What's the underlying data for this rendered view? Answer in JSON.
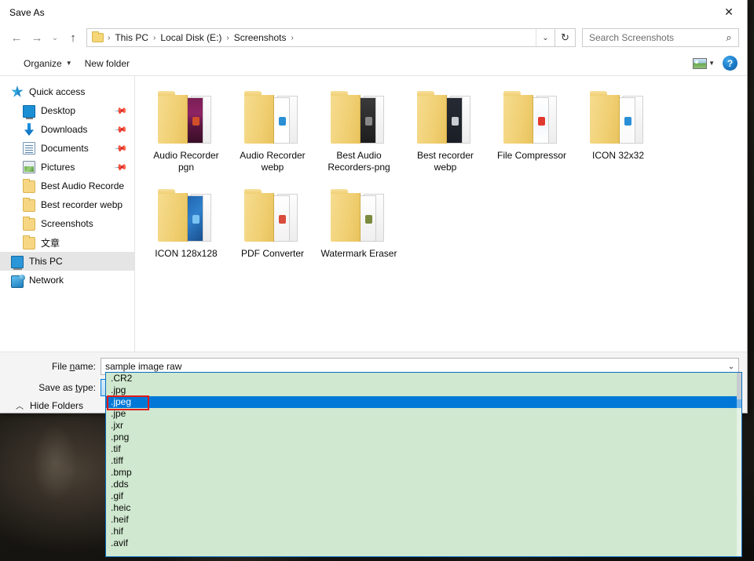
{
  "window": {
    "title": "Save As",
    "close_label": "✕"
  },
  "nav": {
    "back_icon": "←",
    "forward_icon": "→",
    "recent_icon": "⌄",
    "up_icon": "↑",
    "breadcrumbs": [
      "This PC",
      "Local Disk (E:)",
      "Screenshots"
    ],
    "separator": "›",
    "address_chevron": "⌄",
    "refresh_icon": "↻"
  },
  "search": {
    "placeholder": "Search Screenshots",
    "value": "",
    "icon": "⌕"
  },
  "commandbar": {
    "organize_label": "Organize",
    "organize_caret": "▼",
    "new_folder_label": "New folder",
    "view_caret": "▼",
    "help_label": "?"
  },
  "sidebar": {
    "items": [
      {
        "label": "Quick access",
        "icon": "quick-access-icon",
        "indent": 0,
        "pinned": false,
        "selected": false
      },
      {
        "label": "Desktop",
        "icon": "desktop-icon",
        "indent": 1,
        "pinned": true,
        "selected": false
      },
      {
        "label": "Downloads",
        "icon": "downloads-icon",
        "indent": 1,
        "pinned": true,
        "selected": false
      },
      {
        "label": "Documents",
        "icon": "documents-icon",
        "indent": 1,
        "pinned": true,
        "selected": false
      },
      {
        "label": "Pictures",
        "icon": "pictures-icon",
        "indent": 1,
        "pinned": true,
        "selected": false
      },
      {
        "label": "Best Audio Recorde",
        "icon": "folder-icon",
        "indent": 1,
        "pinned": false,
        "selected": false
      },
      {
        "label": "Best recorder webp",
        "icon": "folder-icon",
        "indent": 1,
        "pinned": false,
        "selected": false
      },
      {
        "label": "Screenshots",
        "icon": "folder-icon",
        "indent": 1,
        "pinned": false,
        "selected": false
      },
      {
        "label": "文章",
        "icon": "folder-icon",
        "indent": 1,
        "pinned": false,
        "selected": false
      },
      {
        "label": "This PC",
        "icon": "this-pc-icon",
        "indent": 0,
        "pinned": false,
        "selected": true
      },
      {
        "label": "Network",
        "icon": "network-icon",
        "indent": 0,
        "pinned": false,
        "selected": false
      }
    ],
    "pin_glyph": "📌"
  },
  "files": {
    "items": [
      {
        "name": "Audio Recorder pgn",
        "preview": "purple-ui"
      },
      {
        "name": "Audio Recorder webp",
        "preview": "dark-ui"
      },
      {
        "name": "Best Audio Recorders-png",
        "preview": "dark-doc"
      },
      {
        "name": "Best recorder webp",
        "preview": "dark-panel"
      },
      {
        "name": "File Compressor",
        "preview": "pdf-red"
      },
      {
        "name": "ICON 32x32",
        "preview": "small-blue-icon"
      },
      {
        "name": "ICON 128x128",
        "preview": "blue-tiles"
      },
      {
        "name": "PDF Converter",
        "preview": "doc-list"
      },
      {
        "name": "Watermark Eraser",
        "preview": "photo-doc"
      }
    ]
  },
  "form": {
    "file_name_label": "File name:",
    "file_name_value": "sample image raw",
    "save_as_type_label": "Save as type:",
    "save_as_type_value": ".CR2",
    "combo_chevron": "⌄",
    "hide_folders_label": "Hide Folders",
    "hide_folders_chevron": "︿"
  },
  "type_dropdown": {
    "open": true,
    "selected_index": 2,
    "options": [
      ".CR2",
      ".jpg",
      ".jpeg",
      ".jpe",
      ".jxr",
      ".png",
      ".tif",
      ".tiff",
      ".bmp",
      ".dds",
      ".gif",
      ".heic",
      ".heif",
      ".hif",
      ".avif"
    ]
  },
  "colors": {
    "accent": "#0078d7",
    "dropdown_background": "#cfe8cf",
    "dropdown_border": "#0a6ebd",
    "annotation": "#e01b1b",
    "combo_focus": "#bcdff6",
    "sidebar_selected": "#e5e5e5"
  }
}
